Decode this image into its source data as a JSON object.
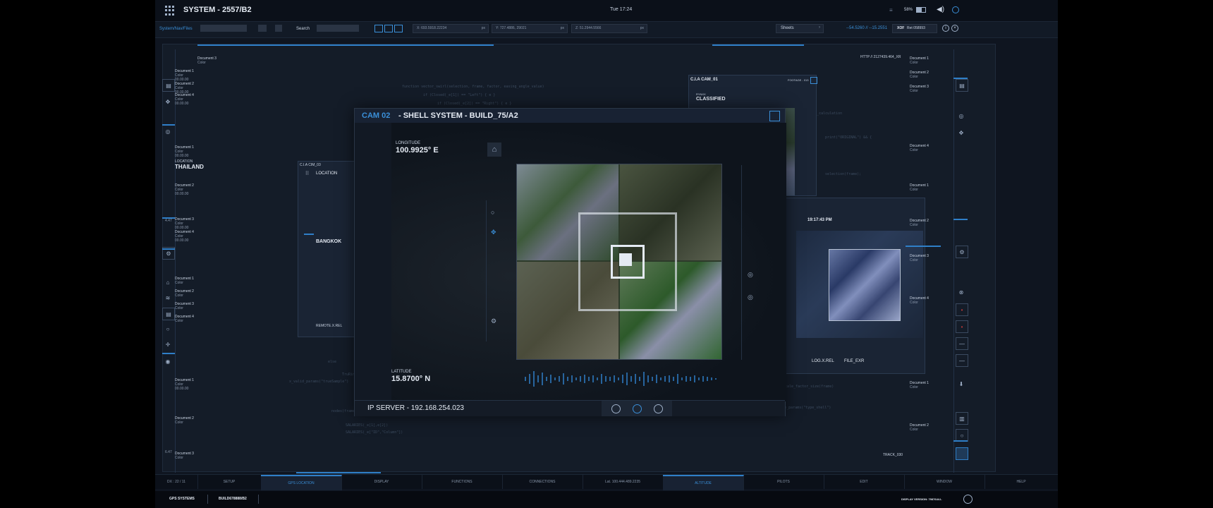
{
  "topbar": {
    "title": "SYSTEM - 2557/B2",
    "clock": "Tue  17:24",
    "battery": "58%"
  },
  "toolbar": {
    "breadcrumb": "System/Nav/Files",
    "search_label": "Search",
    "coord_x": "X: 693.5918.22234",
    "coord_y": "Y: 727.4886, 29021",
    "coord_z": "Z: 51.2944.5566",
    "unit": "px",
    "sheets_select": "Sheets",
    "offset": "--54.5260 // --15.2551",
    "xof_label": "XOF",
    "xof_value": "Ret 058993"
  },
  "left_panel": {
    "location_label": "LOCATION",
    "location_value": "THAILAND",
    "readout_a": "4.47",
    "readout_b": "6.47"
  },
  "location_window": {
    "title": "C.I.A CIM_03",
    "header": "LOCATION",
    "city": "BANGKOK",
    "footer": "REMOTE.X.REL"
  },
  "cam_window": {
    "cam": "CAM 02",
    "title": "- SHELL SYSTEM - BUILD_75/A2",
    "longitude_label": "LONGITUDE",
    "longitude_value": "100.9925° E",
    "latitude_label": "LATITUDE",
    "latitude_value": "15.8700° N",
    "ip_server": "IP SERVER - 192.168.254.023"
  },
  "classified_window": {
    "title": "C.I.A CAM_01",
    "footage": "FOOTAGE - 013",
    "sub": "RYNXX",
    "status": "CLASSIFIED"
  },
  "map_window": {
    "time": "19:17:43 PM",
    "file_a": "LOG.X.REL",
    "file_b": "FILE_EXR"
  },
  "right_panel": {
    "http": "HTTP // 2127439.464_XR",
    "track": "TRACK_030"
  },
  "bottom_tabs": [
    "GPS LOCATION",
    "DISPLAY",
    "FUNCTIONS",
    "CONNECTIONS",
    "Lat. 100.444.489.2235",
    "ALTITUDE",
    "PILOTS",
    "EDIT",
    "WINDOW",
    "HELP"
  ],
  "bottom_left": "DX : 22 / 11",
  "bottom_first_tab": "SETUP",
  "status": {
    "left": "GPS SYSTEMS",
    "build": "BUILD678888/B2",
    "version": "DISPLAY VERSION: 7987644.L"
  },
  "documents": [
    {
      "name": "Document 1",
      "l1": "Color",
      "l2": "00.00.00"
    },
    {
      "name": "Document 2",
      "l1": "Color",
      "l2": "00.00.00"
    },
    {
      "name": "Document 3",
      "l1": "Color",
      "l2": "00.00.00"
    },
    {
      "name": "Document 4",
      "l1": "Color",
      "l2": "00.00.00"
    }
  ],
  "colors": {
    "accent": "#3a8fd8",
    "alert": "#c23a3a",
    "bg": "#0f1520"
  }
}
